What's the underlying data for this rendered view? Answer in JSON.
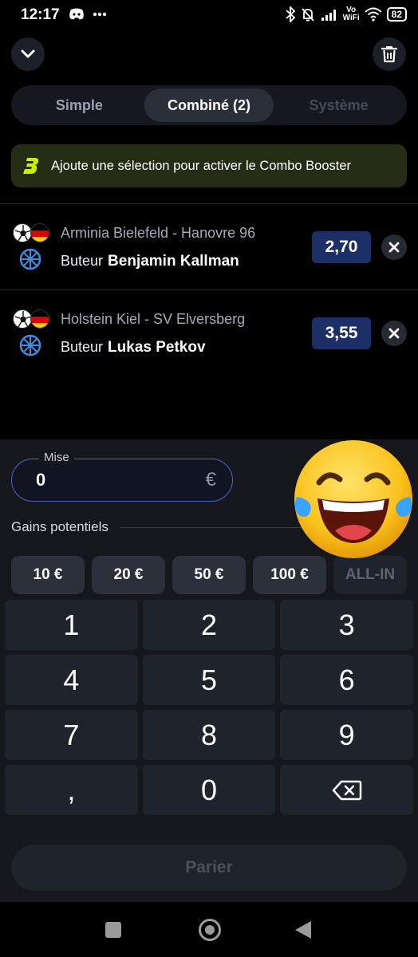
{
  "status_bar": {
    "time": "12:17",
    "vowifi_top": "Vo",
    "vowifi_bottom": "WiFi",
    "battery": "82"
  },
  "header": {
    "collapse_icon": "chevron-down-icon",
    "delete_icon": "trash-icon"
  },
  "tabs": [
    {
      "label": "Simple",
      "state": "inactive"
    },
    {
      "label": "Combiné (2)",
      "state": "active"
    },
    {
      "label": "Système",
      "state": "disabled"
    }
  ],
  "booster": {
    "text": "Ajoute une sélection pour activer le Combo Booster",
    "accent_color": "#c8f000"
  },
  "selections": [
    {
      "match": "Arminia Bielefeld - Hanovre 96",
      "market": "Buteur",
      "player": "Benjamin Kallman",
      "odds": "2,70"
    },
    {
      "match": "Holstein Kiel - SV Elversberg",
      "market": "Buteur",
      "player": "Lukas Petkov",
      "odds": "3,55"
    }
  ],
  "stake": {
    "label": "Mise",
    "value": "0",
    "currency": "€"
  },
  "gains": {
    "label": "Gains potentiels"
  },
  "quick_amounts": [
    "10 €",
    "20 €",
    "50 €",
    "100 €",
    "ALL-IN"
  ],
  "keypad": [
    "1",
    "2",
    "3",
    "4",
    "5",
    "6",
    "7",
    "8",
    "9",
    ",",
    "0"
  ],
  "bet_button": "Parier",
  "colors": {
    "odds_bg": "#1d2f67",
    "stake_border": "#4a67c8"
  }
}
